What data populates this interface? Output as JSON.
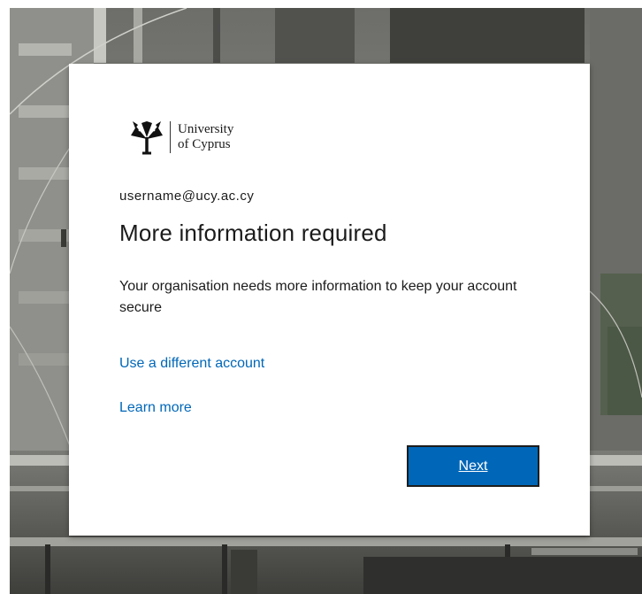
{
  "brand": {
    "name_line1": "University",
    "name_line2": "of Cyprus"
  },
  "signin": {
    "account": "username@ucy.ac.cy",
    "title": "More information required",
    "description": "Your organisation needs more information to keep your account secure",
    "links": {
      "different_account": "Use a different account",
      "learn_more": "Learn more"
    },
    "next_label": "Next"
  },
  "colors": {
    "link": "#0067b8",
    "button": "#0067b8",
    "text": "#1b1b1b"
  },
  "icons": {
    "logo": "university-tree-logo-icon"
  }
}
